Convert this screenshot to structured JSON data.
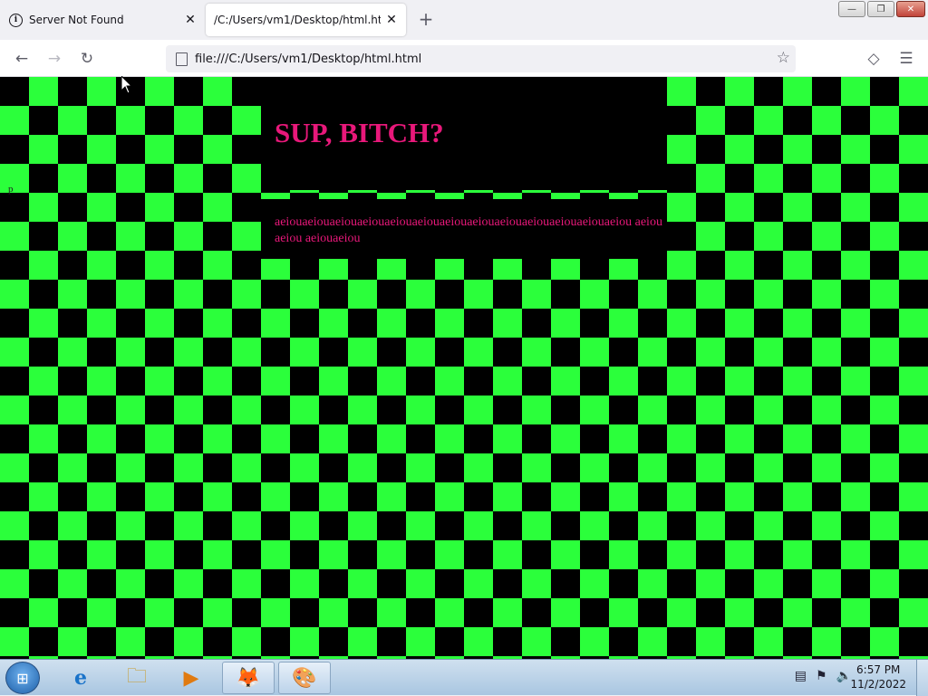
{
  "browser": {
    "tabs": [
      {
        "title": "Server Not Found",
        "icon": "info-icon",
        "active": false
      },
      {
        "title": "/C:/Users/vm1/Desktop/html.html",
        "icon": "none",
        "active": true
      }
    ],
    "new_tab_symbol": "+",
    "tab_close_symbol": "✕",
    "url": "file:///C:/Users/vm1/Desktop/html.html",
    "nav": {
      "back": "←",
      "forward": "→",
      "reload": "↻"
    },
    "bookmark_symbol": "☆",
    "pocket_symbol": "◇",
    "menu_symbol": "☰",
    "window_buttons": {
      "minimize": "—",
      "maximize": "❐",
      "close": "✕"
    }
  },
  "page": {
    "heading": "SUP, BITCH?",
    "paragraph": "aeiouaeiouaeiouaeiouaeiouaeiouaeiouaeiouaeiouaeiouaeiouaeiouaeiou aeiou aeiou aeiouaeiou",
    "stray_text": "p",
    "colors": {
      "text": "#e8187a",
      "check_light": "#2bff3b",
      "check_dark": "#000000",
      "box": "#000000"
    }
  },
  "taskbar": {
    "items": [
      {
        "name": "internet-explorer-icon",
        "glyph": "e"
      },
      {
        "name": "file-explorer-icon",
        "glyph": "🗀"
      },
      {
        "name": "media-player-icon",
        "glyph": "▶"
      },
      {
        "name": "firefox-icon",
        "glyph": "🦊"
      },
      {
        "name": "paint-icon",
        "glyph": "🎨"
      }
    ],
    "time": "6:57 PM",
    "date": "11/2/2022"
  }
}
